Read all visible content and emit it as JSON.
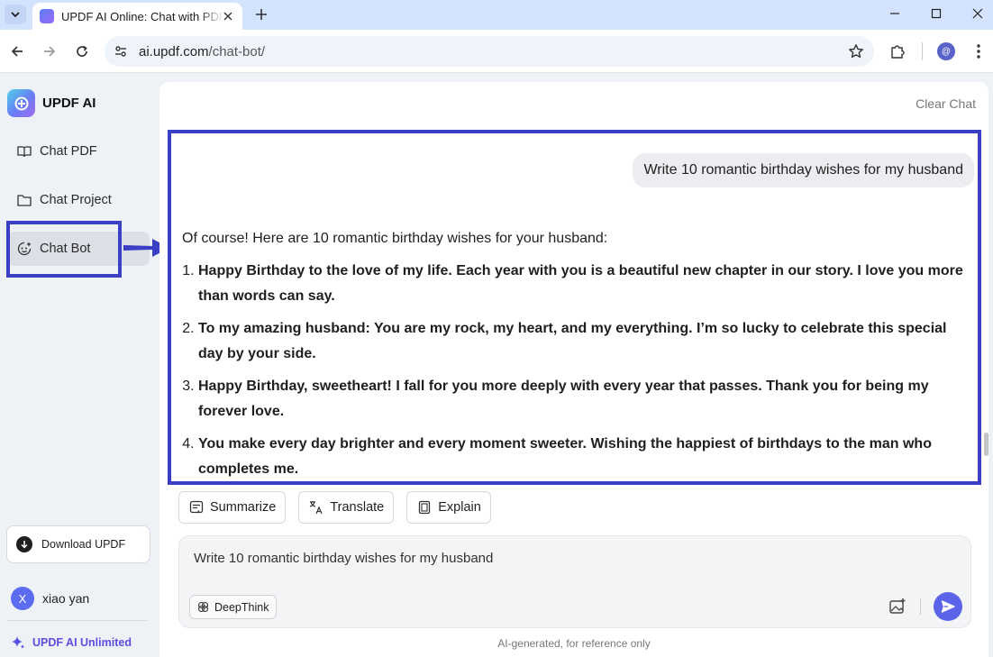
{
  "browser": {
    "tab_title": "UPDF AI Online: Chat with PDF",
    "url_host": "ai.updf.com",
    "url_path": "/chat-bot/",
    "profile_initial": "@"
  },
  "sidebar": {
    "brand": "UPDF AI",
    "items": [
      {
        "label": "Chat PDF",
        "icon": "book-open-icon"
      },
      {
        "label": "Chat Project",
        "icon": "folder-icon"
      },
      {
        "label": "Chat Bot",
        "icon": "bot-icon",
        "active": true
      }
    ],
    "download_label": "Download UPDF",
    "user_name": "xiao yan",
    "user_initial": "X",
    "unlimited_label": "UPDF AI Unlimited"
  },
  "main": {
    "clear_chat": "Clear Chat",
    "user_message": "Write 10 romantic birthday wishes for my husband",
    "answer_intro": "Of course! Here are 10 romantic birthday wishes for your husband:",
    "answer_items": [
      "Happy Birthday to the love of my life. Each year with you is a beautiful new chapter in our story. I love you more than words can say.",
      "To my amazing husband: You are my rock, my heart, and my everything. I’m so lucky to celebrate this special day by your side.",
      "Happy Birthday, sweetheart! I fall for you more deeply with every year that passes. Thank you for being my forever love.",
      "You make every day brighter and every moment sweeter. Wishing the happiest of birthdays to the man who completes me."
    ],
    "actions": {
      "summarize": "Summarize",
      "translate": "Translate",
      "explain": "Explain"
    },
    "composer_text": "Write 10 romantic birthday wishes for my husband",
    "deepthink": "DeepThink",
    "disclaimer": "AI-generated, for reference only"
  },
  "colors": {
    "highlight": "#3b3fc3",
    "accent": "#5b63e8",
    "unlimited": "#5a4fe0"
  }
}
